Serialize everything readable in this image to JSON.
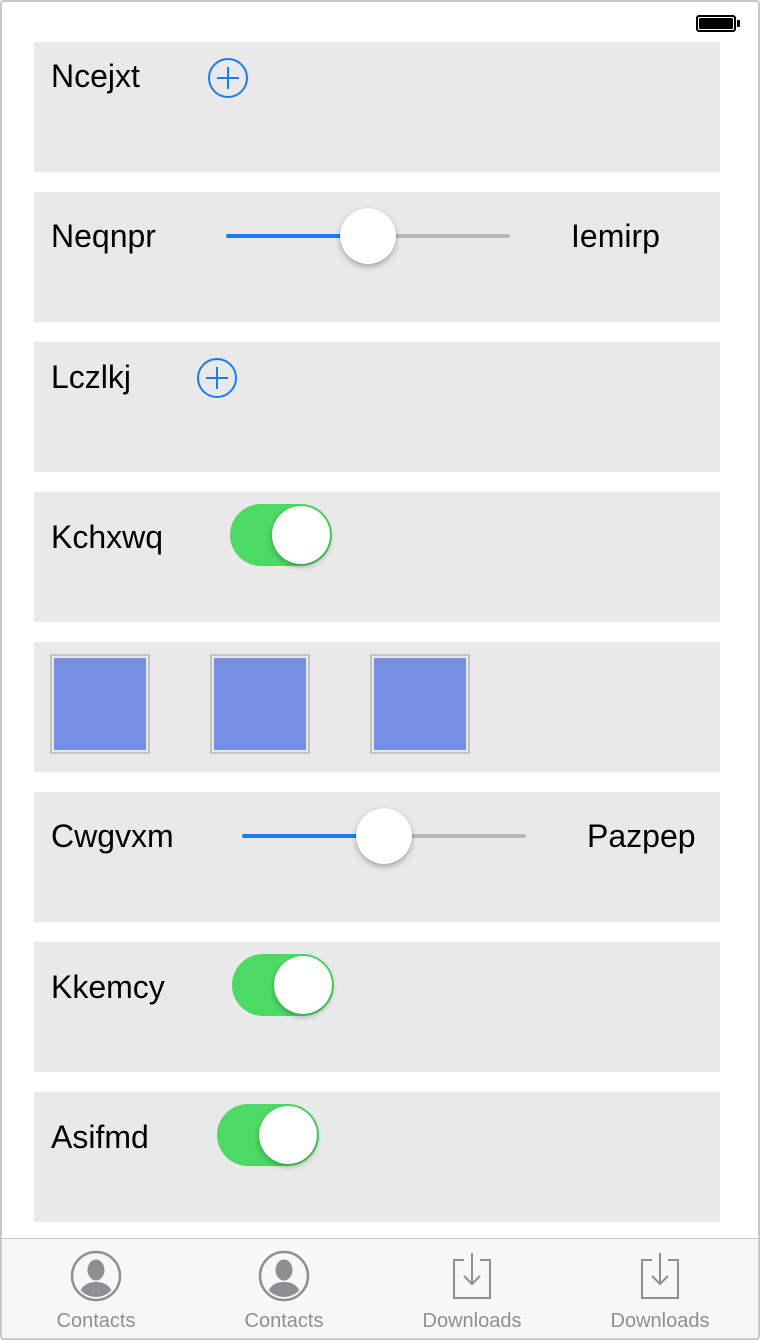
{
  "status_bar": {
    "battery_icon": "battery-full-icon"
  },
  "rows": {
    "r1": {
      "label": "Ncejxt",
      "control": "plus-circle-icon"
    },
    "r2": {
      "label": "Neqnpr",
      "right_label": "Iemirp",
      "slider_value": 0.5
    },
    "r3": {
      "label": "Lczlkj",
      "control": "plus-circle-icon"
    },
    "r4": {
      "label": "Kchxwq",
      "toggle_on": true
    },
    "r5": {
      "swatch_color": "#7890e3",
      "swatch_count": 3
    },
    "r6": {
      "label": "Cwgvxm",
      "right_label": "Pazpep",
      "slider_value": 0.5
    },
    "r7": {
      "label": "Kkemcy",
      "toggle_on": true
    },
    "r8": {
      "label": "Asifmd",
      "toggle_on": true
    }
  },
  "colors": {
    "accent": "#1a7cf0",
    "toggle_on": "#4cd964",
    "row_background": "#e9e9e9",
    "tab_label": "#8e8e93"
  },
  "tabbar": {
    "tabs": [
      {
        "label": "Contacts",
        "icon": "contact-avatar-icon"
      },
      {
        "label": "Contacts",
        "icon": "contact-avatar-icon"
      },
      {
        "label": "Downloads",
        "icon": "download-tray-icon"
      },
      {
        "label": "Downloads",
        "icon": "download-tray-icon"
      }
    ]
  }
}
